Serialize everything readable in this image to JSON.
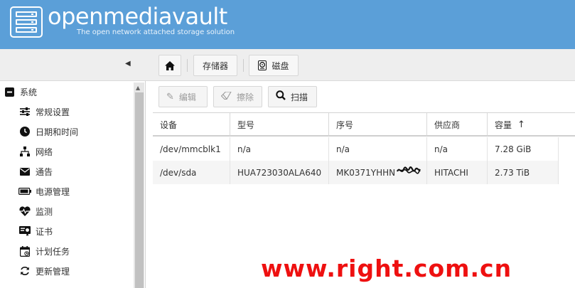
{
  "header": {
    "brand": "openmediavault",
    "tagline": "The open network attached storage solution"
  },
  "breadcrumb": {
    "home_icon": "home-icon",
    "items": [
      {
        "label": "存储器"
      },
      {
        "label": "磁盘",
        "icon": "hard-drive-icon"
      }
    ]
  },
  "toolbar": {
    "edit_label": "编辑",
    "wipe_label": "擦除",
    "scan_label": "扫描"
  },
  "sidebar": {
    "items": [
      {
        "label": "系统",
        "icon": "minus-square-icon"
      },
      {
        "label": "常规设置",
        "icon": "sliders-icon"
      },
      {
        "label": "日期和时间",
        "icon": "clock-icon"
      },
      {
        "label": "网络",
        "icon": "network-icon"
      },
      {
        "label": "通告",
        "icon": "envelope-icon"
      },
      {
        "label": "电源管理",
        "icon": "battery-icon"
      },
      {
        "label": "监测",
        "icon": "heartbeat-icon"
      },
      {
        "label": "证书",
        "icon": "certificate-icon"
      },
      {
        "label": "计划任务",
        "icon": "calendar-icon"
      },
      {
        "label": "更新管理",
        "icon": "refresh-icon"
      }
    ]
  },
  "grid": {
    "columns": [
      "设备",
      "型号",
      "序号",
      "供应商",
      "容量"
    ],
    "rows": [
      {
        "device": "/dev/mmcblk1",
        "model": "n/a",
        "serial": "n/a",
        "vendor": "n/a",
        "capacity": "7.28 GiB"
      },
      {
        "device": "/dev/sda",
        "model": "HUA723030ALA640",
        "serial": "MK0371YHHN",
        "vendor": "HITACHI",
        "capacity": "2.73 TiB"
      }
    ]
  },
  "watermark": "www.right.com.cn",
  "colors": {
    "header_bg": "#5b9fd8",
    "watermark": "#ee1010"
  }
}
